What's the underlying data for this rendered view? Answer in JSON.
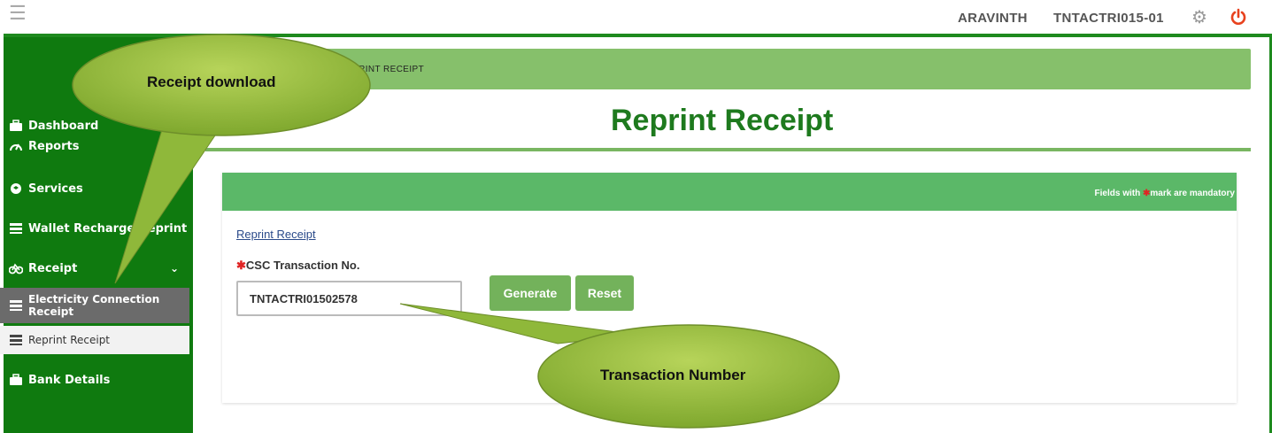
{
  "header": {
    "user_name": "ARAVINTH",
    "user_id": "TNTACTRI015-01"
  },
  "sidebar": {
    "items": [
      {
        "label": "Dashboard",
        "icon": "briefcase-icon"
      },
      {
        "label": "Reports",
        "icon": "speedometer-icon"
      },
      {
        "label": "Services",
        "icon": "box-icon"
      },
      {
        "label": "Wallet Recharge Reprint",
        "icon": "list-icon"
      },
      {
        "label": "Receipt",
        "icon": "bicycle-icon"
      },
      {
        "label": "Electricity Connection Receipt",
        "icon": "list-icon"
      },
      {
        "label": "Reprint Receipt",
        "icon": "list-icon"
      },
      {
        "label": "Bank Details",
        "icon": "briefcase-icon"
      }
    ]
  },
  "breadcrumb": "PRINT RECEIPT",
  "page_title": "Reprint Receipt",
  "form": {
    "mandatory_note_prefix": "Fields with ",
    "mandatory_note_suffix": "mark are mandatory",
    "link_label": "Reprint Receipt",
    "field_label": "CSC Transaction No.",
    "field_value": "TNTACTRI01502578",
    "generate_label": "Generate",
    "reset_label": "Reset"
  },
  "callouts": {
    "receipt_download": "Receipt download",
    "transaction_number": "Transaction Number"
  },
  "colors": {
    "sidebar_bg": "#0f7a0f",
    "title_green": "#1e7a1e",
    "button_green": "#73b25b",
    "callout_green": "#8fb83a",
    "power_red": "#e8421e"
  }
}
